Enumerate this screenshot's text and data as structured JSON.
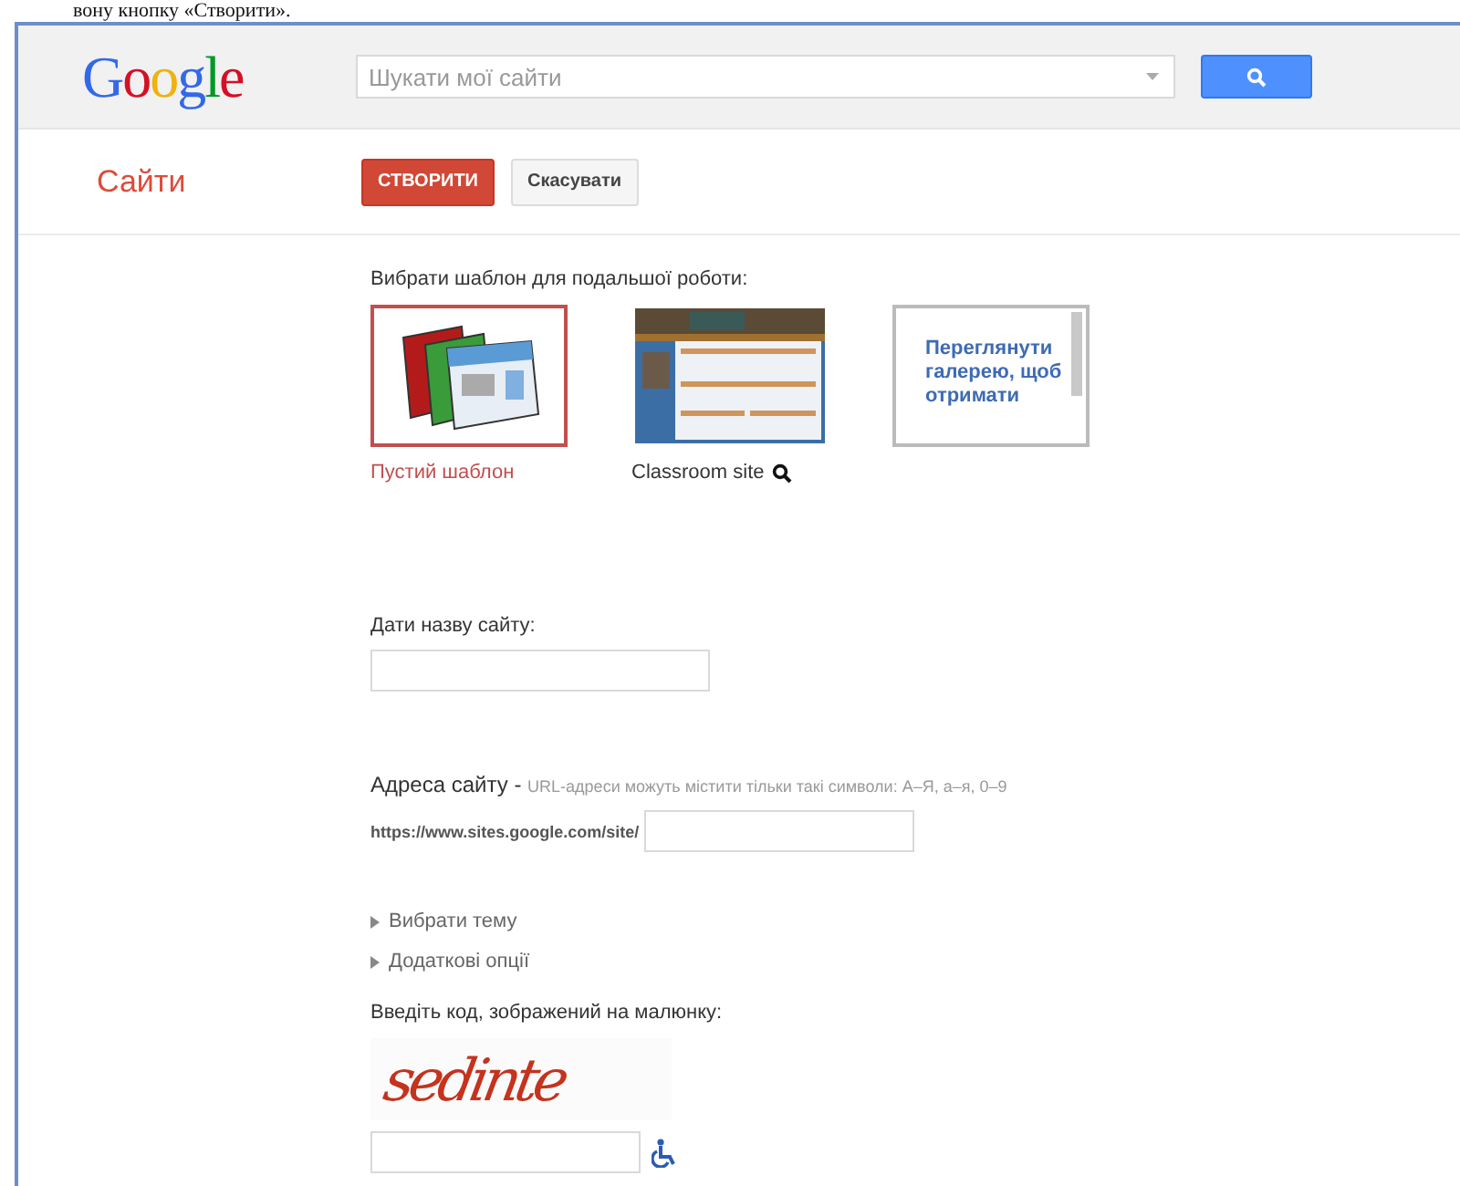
{
  "document_caption": "вону кнопку «Створити».",
  "header": {
    "logo": "Google",
    "search": {
      "placeholder": "Шукати мої сайти"
    }
  },
  "app_title": "Сайти",
  "buttons": [
    {
      "label": "СТВОРИТИ",
      "kind": "primary"
    },
    {
      "label": "Скасувати",
      "kind": "secondary"
    }
  ],
  "templates": {
    "heading": "Вибрати шаблон для подальшої роботи:",
    "items": [
      {
        "kind": "blank",
        "label": "Пустий шаблон",
        "selected": true
      },
      {
        "kind": "picture",
        "label": "Classroom site",
        "selected": false
      },
      {
        "kind": "gallery",
        "text": "Переглянути галерею, щоб отримати",
        "selected": false
      }
    ]
  },
  "site_name": {
    "label": "Дати назву сайту:"
  },
  "site_address": {
    "label": "Адреса сайту -",
    "hint": "URL-адреси можуть містити тільки такі символи: А–Я, а–я, 0–9",
    "prefix": "https://www.sites.google.com/site/"
  },
  "options": [
    {
      "label": "Вибрати тему",
      "expanded": false
    },
    {
      "label": "Додаткові опції",
      "expanded": false
    }
  ],
  "captcha": {
    "label": "Введіть код, зображений на малюнку:",
    "code": "sedinte"
  }
}
